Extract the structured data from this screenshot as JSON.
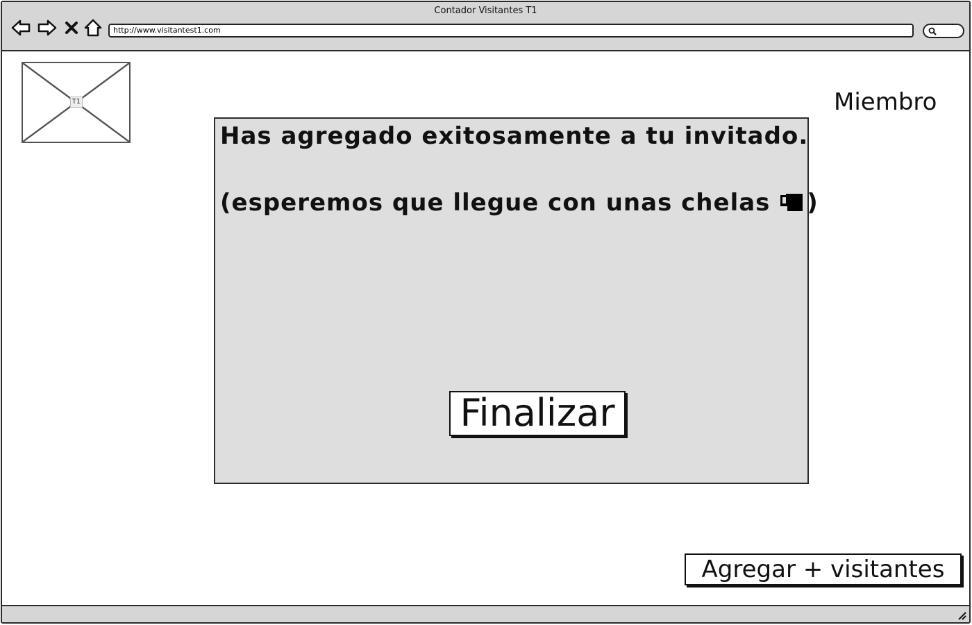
{
  "window": {
    "title": "Contador Visitantes T1",
    "url": "http://www.visitantest1.com"
  },
  "icons": {
    "back": "back-arrow-icon",
    "forward": "forward-arrow-icon",
    "stop": "close-icon",
    "home": "home-icon",
    "search": "search-icon",
    "beer": "beer-mug-icon",
    "resize": "resize-grip-icon"
  },
  "logo": {
    "label": "T1"
  },
  "header": {
    "member_label": "Miembro"
  },
  "dialog": {
    "message": "Has agregado exitosamente a tu invitado.",
    "note_prefix": "(esperemos que llegue con unas chelas ",
    "note_suffix": ")",
    "finalize_label": "Finalizar"
  },
  "footer": {
    "add_visitors_label": "Agregar + visitantes"
  },
  "colors": {
    "chrome": "#d6d6d6",
    "dialog_bg": "#dedede",
    "border": "#2b2b2b"
  }
}
